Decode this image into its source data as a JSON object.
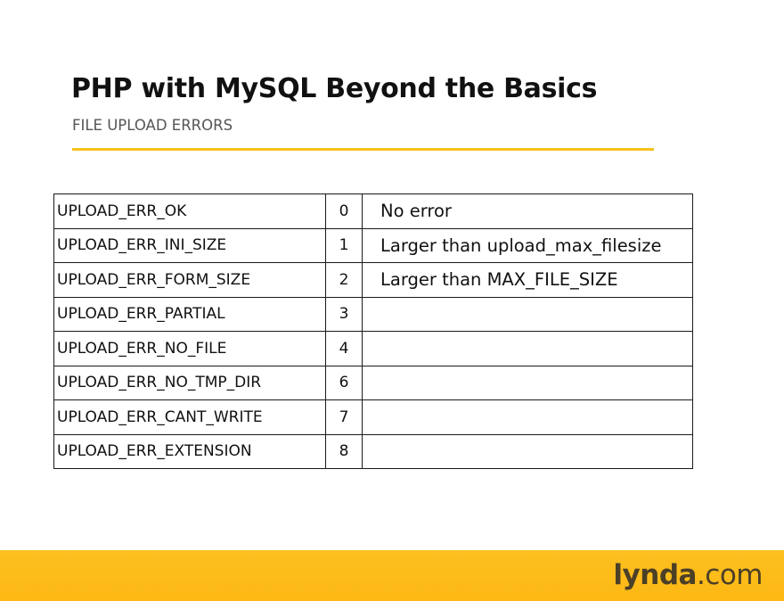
{
  "slide": {
    "title": "PHP with MySQL Beyond the Basics",
    "subtitle": "FILE UPLOAD ERRORS",
    "accent_color": "#f6c21c"
  },
  "table": {
    "rows": [
      {
        "constant": "UPLOAD_ERR_OK",
        "code": "0",
        "description": "No error"
      },
      {
        "constant": "UPLOAD_ERR_INI_SIZE",
        "code": "1",
        "description": "Larger than upload_max_filesize"
      },
      {
        "constant": "UPLOAD_ERR_FORM_SIZE",
        "code": "2",
        "description": "Larger than MAX_FILE_SIZE"
      },
      {
        "constant": "UPLOAD_ERR_PARTIAL",
        "code": "3",
        "description": ""
      },
      {
        "constant": "UPLOAD_ERR_NO_FILE",
        "code": "4",
        "description": ""
      },
      {
        "constant": "UPLOAD_ERR_NO_TMP_DIR",
        "code": "6",
        "description": ""
      },
      {
        "constant": "UPLOAD_ERR_CANT_WRITE",
        "code": "7",
        "description": ""
      },
      {
        "constant": "UPLOAD_ERR_EXTENSION",
        "code": "8",
        "description": ""
      }
    ]
  },
  "footer": {
    "logo_brand": "lynda",
    "logo_suffix": ".com",
    "color": "#fdb813"
  }
}
